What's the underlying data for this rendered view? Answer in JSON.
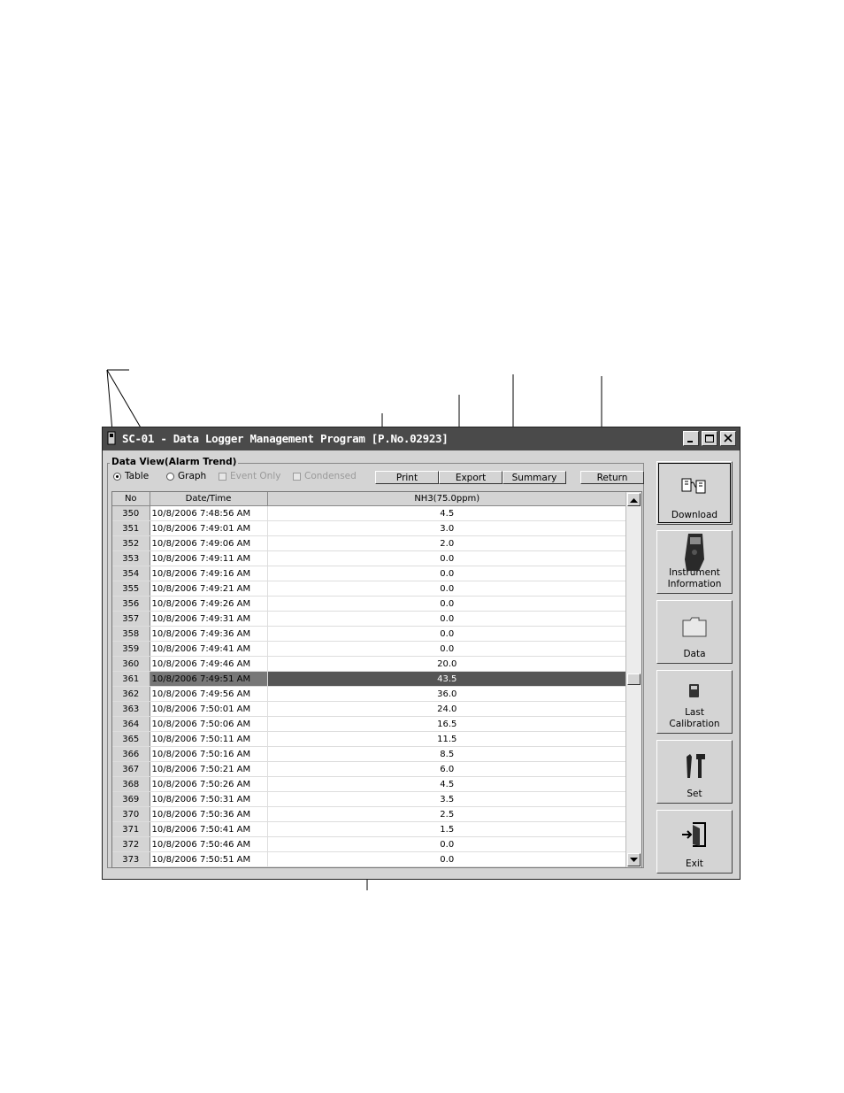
{
  "window": {
    "title": "SC-01 - Data Logger Management Program [P.No.02923]"
  },
  "title_buttons": {
    "minimize_icon": "minimize-icon",
    "maximize_icon": "maximize-icon",
    "close_icon": "close-icon"
  },
  "data_view": {
    "group_label": "Data View(Alarm Trend)",
    "table_label": "Table",
    "table_selected": true,
    "graph_label": "Graph",
    "graph_selected": false,
    "event_only_label": "Event Only",
    "condensed_label": "Condensed",
    "buttons": {
      "print": "Print",
      "export": "Export",
      "summary": "Summary",
      "return": "Return"
    }
  },
  "table": {
    "columns": [
      "No",
      "Date/Time",
      "NH3(75.0ppm)"
    ],
    "selected_row": 11,
    "rows": [
      {
        "no": "350",
        "datetime": "10/8/2006 7:48:56 AM",
        "value": "4.5"
      },
      {
        "no": "351",
        "datetime": "10/8/2006 7:49:01 AM",
        "value": "3.0"
      },
      {
        "no": "352",
        "datetime": "10/8/2006 7:49:06 AM",
        "value": "2.0"
      },
      {
        "no": "353",
        "datetime": "10/8/2006 7:49:11 AM",
        "value": "0.0"
      },
      {
        "no": "354",
        "datetime": "10/8/2006 7:49:16 AM",
        "value": "0.0"
      },
      {
        "no": "355",
        "datetime": "10/8/2006 7:49:21 AM",
        "value": "0.0"
      },
      {
        "no": "356",
        "datetime": "10/8/2006 7:49:26 AM",
        "value": "0.0"
      },
      {
        "no": "357",
        "datetime": "10/8/2006 7:49:31 AM",
        "value": "0.0"
      },
      {
        "no": "358",
        "datetime": "10/8/2006 7:49:36 AM",
        "value": "0.0"
      },
      {
        "no": "359",
        "datetime": "10/8/2006 7:49:41 AM",
        "value": "0.0"
      },
      {
        "no": "360",
        "datetime": "10/8/2006 7:49:46 AM",
        "value": "20.0"
      },
      {
        "no": "361",
        "datetime": "10/8/2006 7:49:51 AM",
        "value": "43.5"
      },
      {
        "no": "362",
        "datetime": "10/8/2006 7:49:56 AM",
        "value": "36.0"
      },
      {
        "no": "363",
        "datetime": "10/8/2006 7:50:01 AM",
        "value": "24.0"
      },
      {
        "no": "364",
        "datetime": "10/8/2006 7:50:06 AM",
        "value": "16.5"
      },
      {
        "no": "365",
        "datetime": "10/8/2006 7:50:11 AM",
        "value": "11.5"
      },
      {
        "no": "366",
        "datetime": "10/8/2006 7:50:16 AM",
        "value": "8.5"
      },
      {
        "no": "367",
        "datetime": "10/8/2006 7:50:21 AM",
        "value": "6.0"
      },
      {
        "no": "368",
        "datetime": "10/8/2006 7:50:26 AM",
        "value": "4.5"
      },
      {
        "no": "369",
        "datetime": "10/8/2006 7:50:31 AM",
        "value": "3.5"
      },
      {
        "no": "370",
        "datetime": "10/8/2006 7:50:36 AM",
        "value": "2.5"
      },
      {
        "no": "371",
        "datetime": "10/8/2006 7:50:41 AM",
        "value": "1.5"
      },
      {
        "no": "372",
        "datetime": "10/8/2006 7:50:46 AM",
        "value": "0.0"
      },
      {
        "no": "373",
        "datetime": "10/8/2006 7:50:51 AM",
        "value": "0.0"
      }
    ]
  },
  "sidebar": {
    "download": {
      "label": "Download",
      "icon": "download-icon"
    },
    "instrument": {
      "label_line1": "Instrument",
      "label_line2": "Information",
      "icon": "instrument-icon"
    },
    "data": {
      "label": "Data",
      "icon": "folder-icon"
    },
    "calibration": {
      "label_line1": "Last",
      "label_line2": "Calibration",
      "icon": "calibration-icon"
    },
    "set": {
      "label": "Set",
      "icon": "tools-icon"
    },
    "exit": {
      "label": "Exit",
      "icon": "exit-door-icon"
    }
  },
  "colors": {
    "titlebar": "#4a4a4a",
    "window_face": "#d4d4d4",
    "selected_row": "#555555"
  }
}
